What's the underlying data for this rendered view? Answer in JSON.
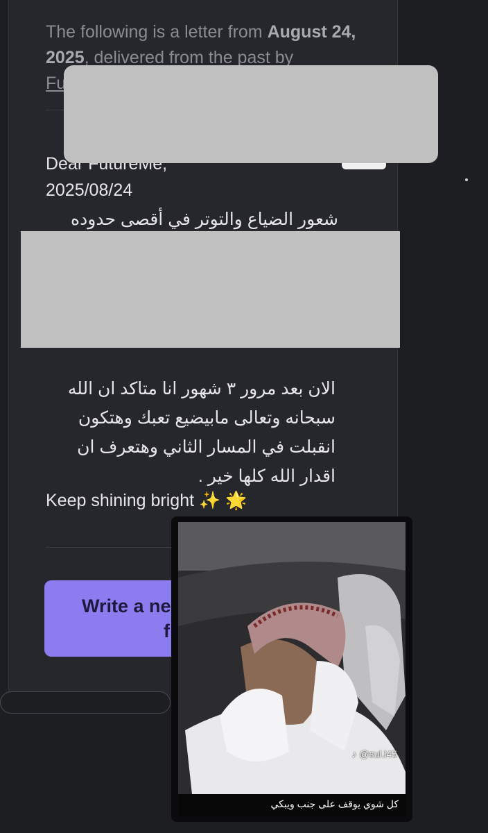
{
  "letter": {
    "intro_prefix": "The following is a letter from ",
    "intro_date": "August 24, 2025",
    "intro_suffix": ", delivered from the past by",
    "intro_link": "Fu",
    "greeting": "Dear FutureMe,",
    "date_line": "2025/08/24",
    "arabic_line_1": "شعور الضياع والتوتر في أقصى حدوده",
    "body_lines": [
      "الان بعد مرور ٣ شهور انا متاكد ان الله",
      "سبحانه وتعالى مابيضيع تعبك وهتكون",
      "انقبلت في المسار الثاني وهتعرف ان",
      "اقدار الله كلها خير ."
    ],
    "sign_off": "Keep shining bright ✨ 🌟"
  },
  "cta": {
    "line1": "Write a ne",
    "line2": "f"
  },
  "video": {
    "watermark": "@sul.l45",
    "caption": "كل شوي يوقف على جنب ويبكي"
  },
  "colors": {
    "background": "#1d1e22",
    "card": "#26272d",
    "cta": "#8b7cf0",
    "redaction": "#c0c0c0"
  }
}
